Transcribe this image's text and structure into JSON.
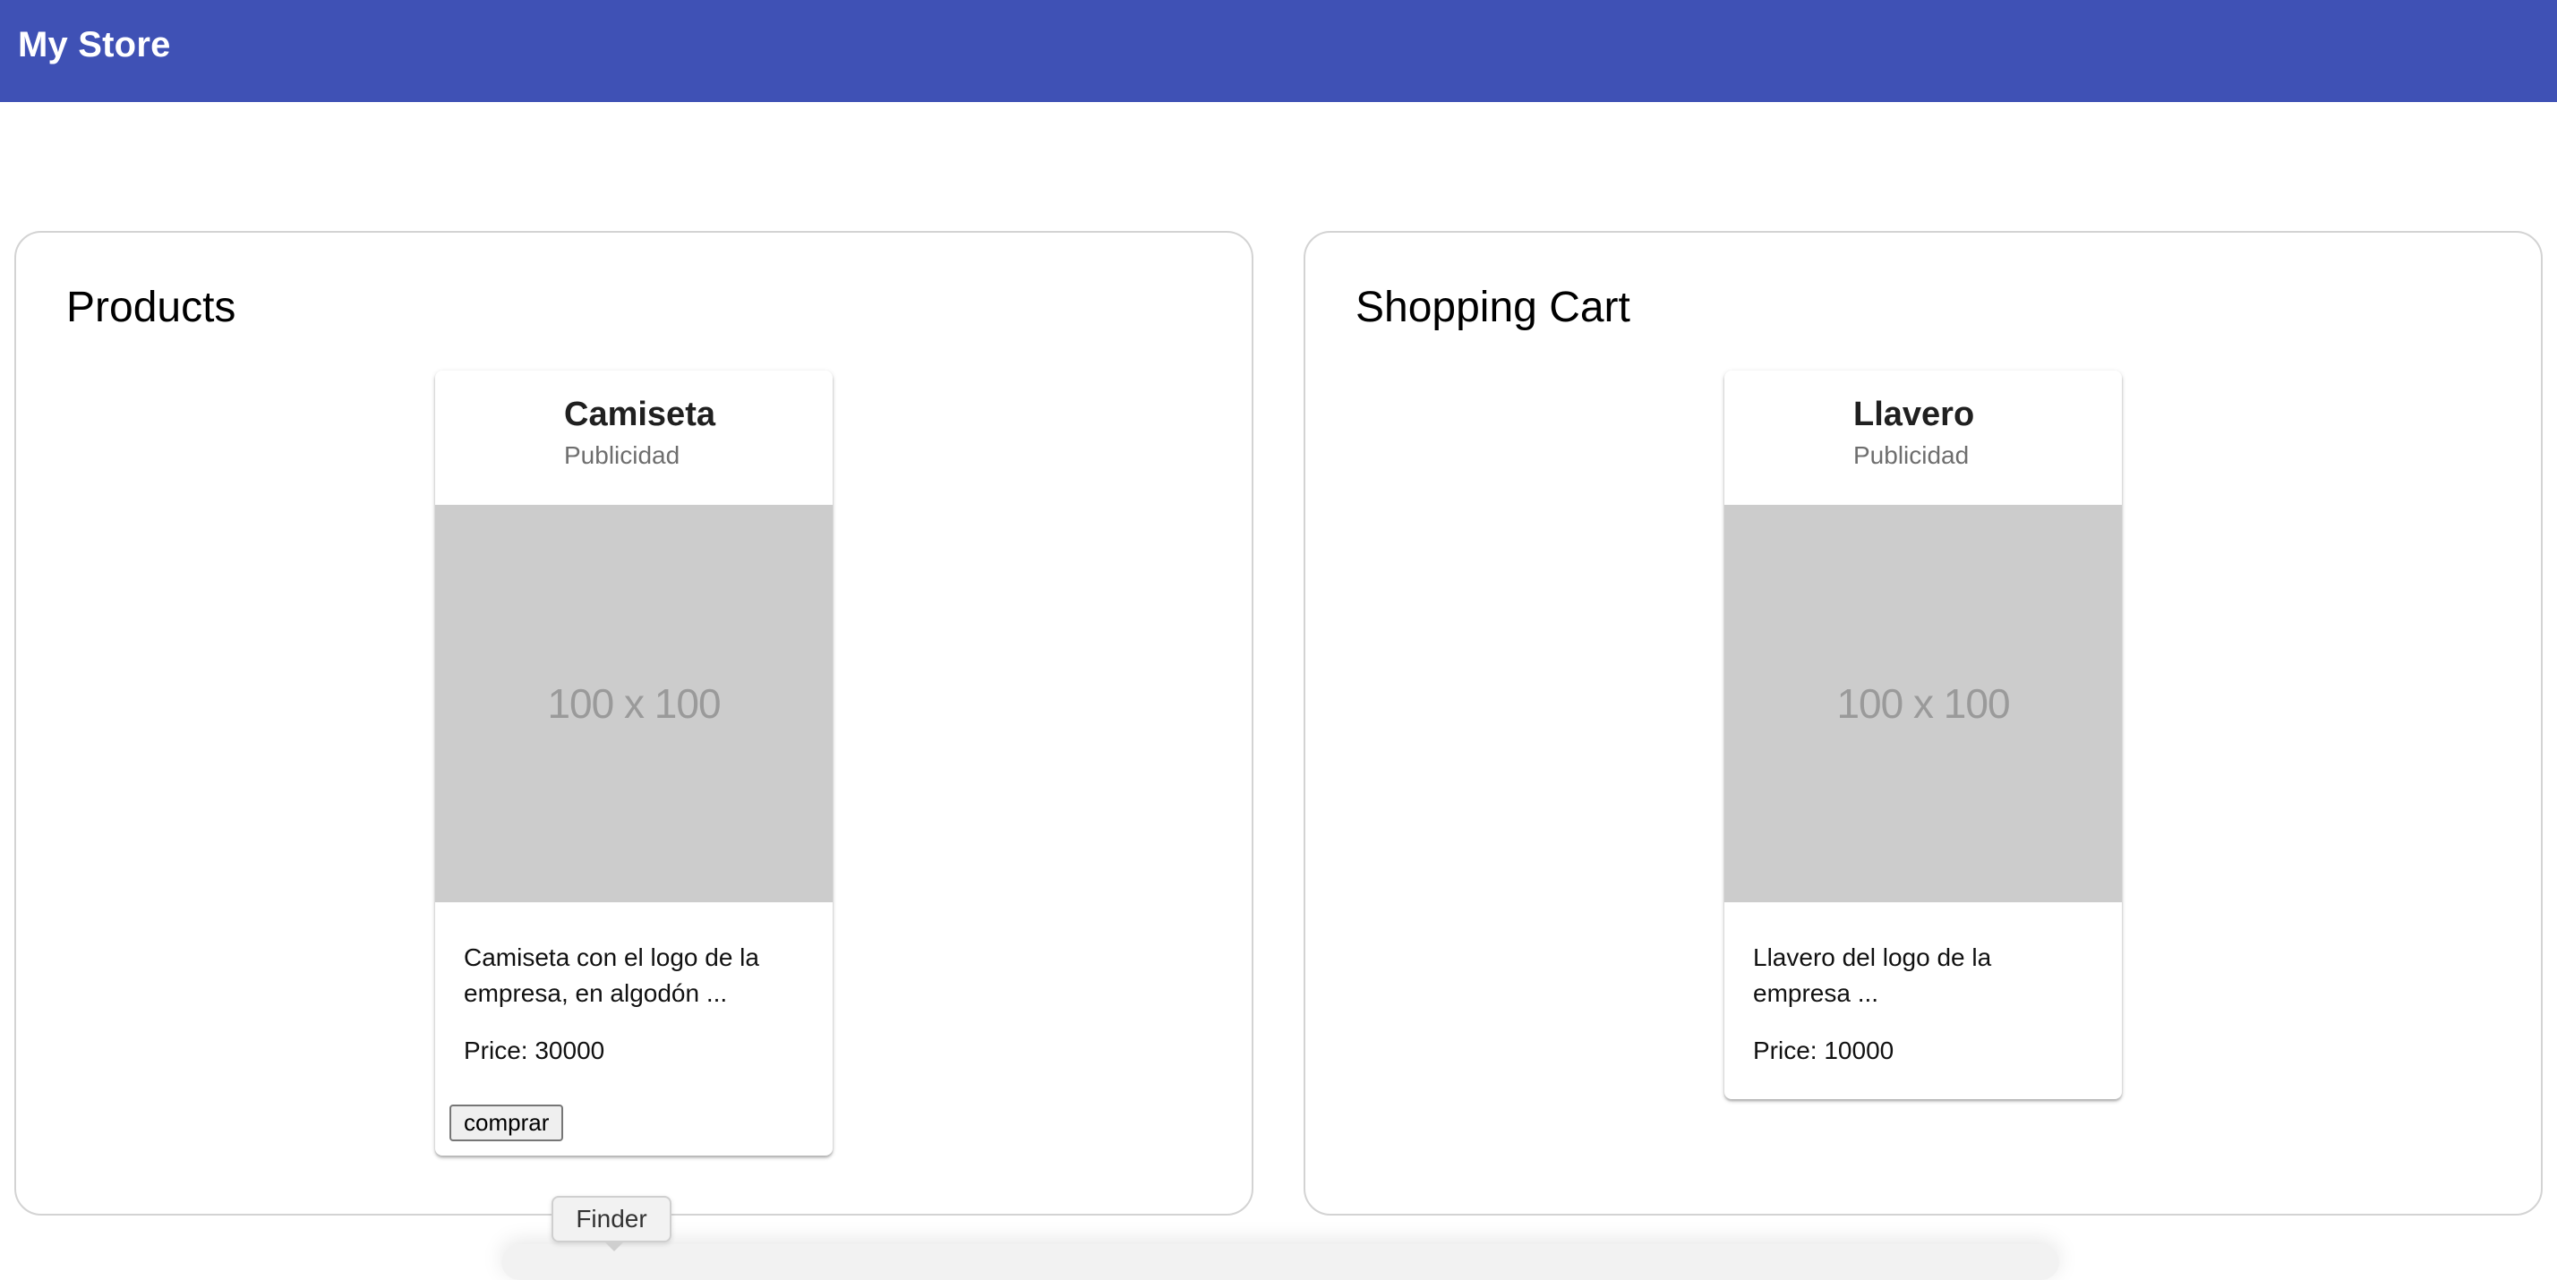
{
  "app": {
    "title": "My Store"
  },
  "products_panel": {
    "title": "Products",
    "items": [
      {
        "name": "Camiseta",
        "category": "Publicidad",
        "image_placeholder": "100 x 100",
        "description": "Camiseta con el logo de la empresa, en algodón ...",
        "price_text": "Price: 30000",
        "buy_label": "comprar"
      }
    ]
  },
  "cart_panel": {
    "title": "Shopping Cart",
    "items": [
      {
        "name": "Llavero",
        "category": "Publicidad",
        "image_placeholder": "100 x 100",
        "description": "Llavero del logo de la empresa ...",
        "price_text": "Price: 10000"
      }
    ]
  },
  "dock": {
    "tooltip": "Finder"
  },
  "colors": {
    "toolbar": "#3f51b5",
    "image_placeholder": "#cccccc",
    "panel_border": "#d3d3d3"
  }
}
